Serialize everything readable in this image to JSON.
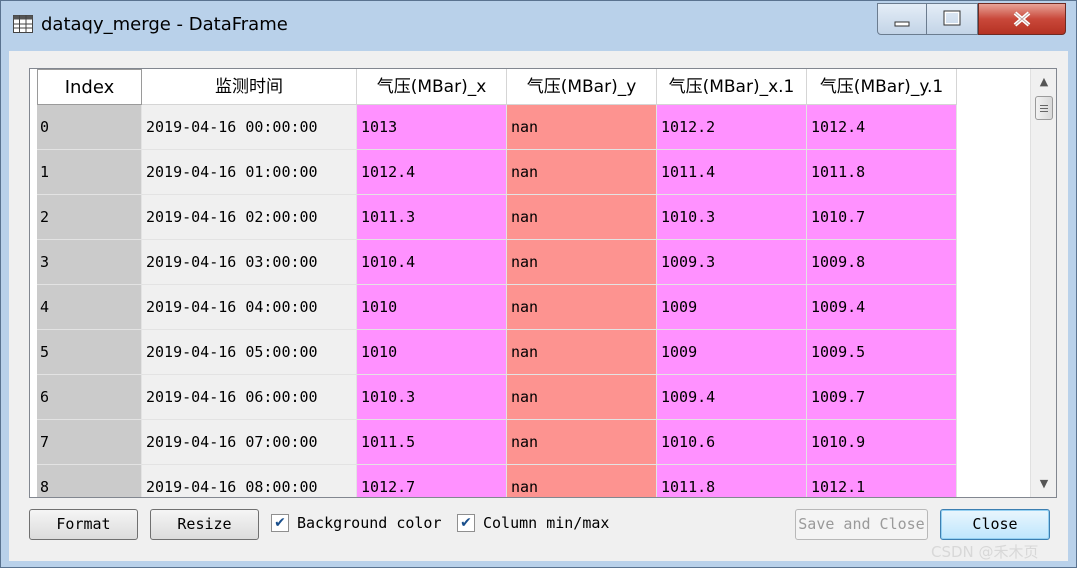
{
  "window": {
    "title": "dataqy_merge - DataFrame",
    "icons": {
      "app": "table-icon",
      "minimize": "minimize-icon",
      "maximize": "maximize-icon",
      "close": "close-x-icon"
    }
  },
  "table": {
    "headers": [
      "Index",
      "监测时间",
      "气压(MBar)_x",
      "气压(MBar)_y",
      "气压(MBar)_x.1",
      "气压(MBar)_y.1"
    ],
    "rows": [
      [
        "0",
        "2019-04-16 00:00:00",
        "1013",
        "nan",
        "1012.2",
        "1012.4"
      ],
      [
        "1",
        "2019-04-16 01:00:00",
        "1012.4",
        "nan",
        "1011.4",
        "1011.8"
      ],
      [
        "2",
        "2019-04-16 02:00:00",
        "1011.3",
        "nan",
        "1010.3",
        "1010.7"
      ],
      [
        "3",
        "2019-04-16 03:00:00",
        "1010.4",
        "nan",
        "1009.3",
        "1009.8"
      ],
      [
        "4",
        "2019-04-16 04:00:00",
        "1010",
        "nan",
        "1009",
        "1009.4"
      ],
      [
        "5",
        "2019-04-16 05:00:00",
        "1010",
        "nan",
        "1009",
        "1009.5"
      ],
      [
        "6",
        "2019-04-16 06:00:00",
        "1010.3",
        "nan",
        "1009.4",
        "1009.7"
      ],
      [
        "7",
        "2019-04-16 07:00:00",
        "1011.5",
        "nan",
        "1010.6",
        "1010.9"
      ],
      [
        "8",
        "2019-04-16 08:00:00",
        "1012.7",
        "nan",
        "1011.8",
        "1012.1"
      ]
    ],
    "colors": {
      "index_bg": "#cbcbcb",
      "time_bg": "#f0f0f0",
      "magenta": "#ff91ff",
      "salmon": "#fd9390"
    }
  },
  "scrollbar": {
    "up_glyph": "▲",
    "down_glyph": "▼"
  },
  "footer": {
    "format_label": "Format",
    "resize_label": "Resize",
    "bg_color_label": "Background color",
    "bg_color_checked": true,
    "col_minmax_label": "Column min/max",
    "col_minmax_checked": true,
    "save_close_label": "Save and Close",
    "close_label": "Close",
    "check_glyph": "✔"
  },
  "watermark": "CSDN @禾木页"
}
